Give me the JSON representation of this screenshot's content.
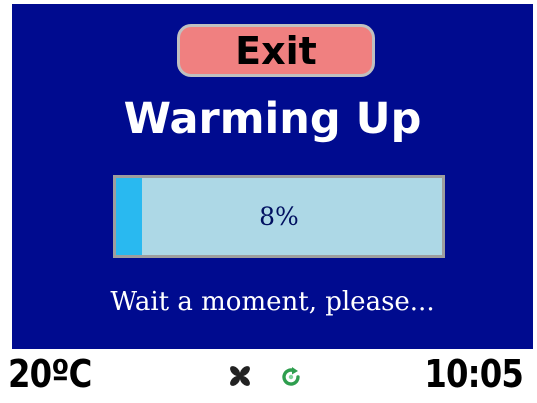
{
  "screen": {
    "exit_label": "Exit",
    "title": "Warming Up",
    "progress": {
      "value_percent": 8,
      "label": "8%"
    },
    "message": "Wait a moment, please..."
  },
  "status_bar": {
    "temperature": "20ºC",
    "time": "10:05",
    "icons": [
      "fan-icon",
      "refresh-icon"
    ]
  },
  "colors": {
    "screen_background": "#000b8f",
    "exit_button": "#f08080",
    "progress_track": "#add8e6",
    "progress_fill": "#29b9f0",
    "refresh_icon": "#2e9e4e"
  }
}
